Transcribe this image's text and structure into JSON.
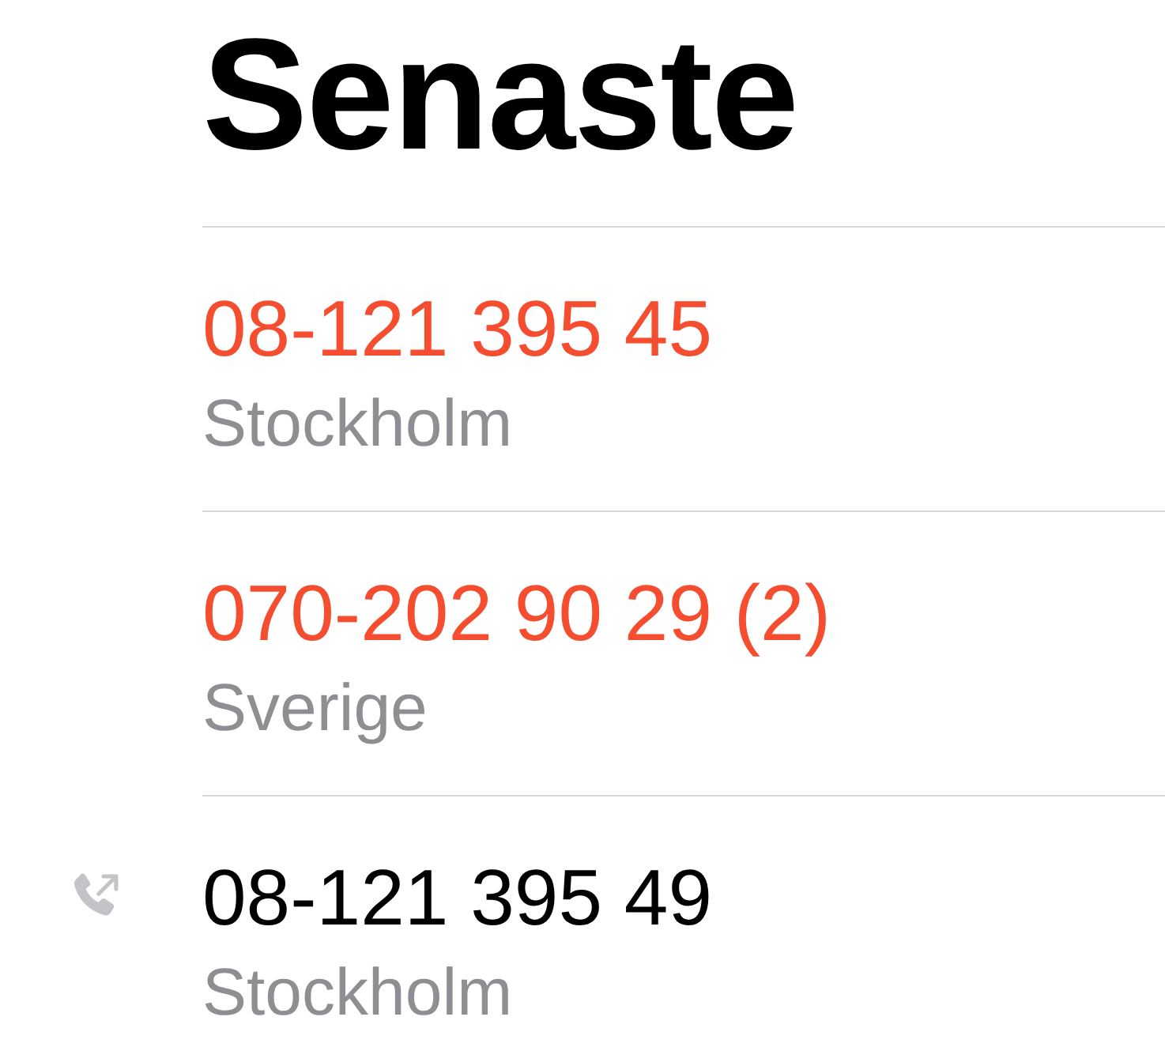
{
  "title": "Senaste",
  "calls": [
    {
      "kind": "missed",
      "number": "08-121 395 45",
      "location": "Stockholm"
    },
    {
      "kind": "missed",
      "number": "070-202 90 29 (2)",
      "location": "Sverige"
    },
    {
      "kind": "outgoing",
      "number": "08-121 395 49",
      "location": "Stockholm"
    }
  ]
}
